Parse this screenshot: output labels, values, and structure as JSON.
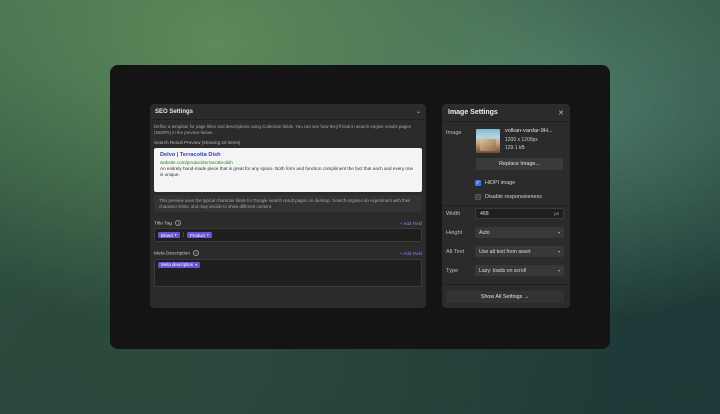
{
  "seo": {
    "title": "SEO Settings",
    "description": "Define a template for page titles and descriptions using Collection fields. You can see how they'll look in search engine results pages (SERPs) in the preview below.",
    "preview_heading": "Search Result Preview (showing 20 items)",
    "preview": {
      "title": "Delvo | Terracotta Dish",
      "url": "website.com/product/terracotta-dish",
      "description": "An entirely hand-made piece that is great for any space. Both form and function compliment the fact that each and every one is unique."
    },
    "note": "This preview uses the typical character limits for Google search result pages on desktop. Search engines do experiment with their character limits, and may decide to show different content.",
    "title_tag": {
      "label": "Title Tag",
      "add_label": "+ Add Field",
      "pills": [
        "Brand",
        "Product"
      ],
      "separator": "|"
    },
    "meta_description": {
      "label": "Meta Description",
      "add_label": "+ Add Field",
      "pills": [
        "Meta description"
      ]
    }
  },
  "image_settings": {
    "title": "Image Settings",
    "image_label": "Image",
    "file_name": "volkan-vardar-9H...",
    "dimensions": "1200 x 1200px",
    "file_size": "129.1 kB",
    "replace_label": "Replace Image...",
    "hidpi_label": "HiDPI image",
    "hidpi_checked": true,
    "disable_resp_label": "Disable responsiveness",
    "disable_resp_checked": false,
    "width_label": "Width",
    "width_value": "468",
    "width_unit": "px",
    "height_label": "Height",
    "height_value": "Auto",
    "alt_label": "Alt Text",
    "alt_value": "Use alt text from asset",
    "type_label": "Type",
    "type_value": "Lazy: loads on scroll",
    "show_all_label": "Show All Settings"
  }
}
